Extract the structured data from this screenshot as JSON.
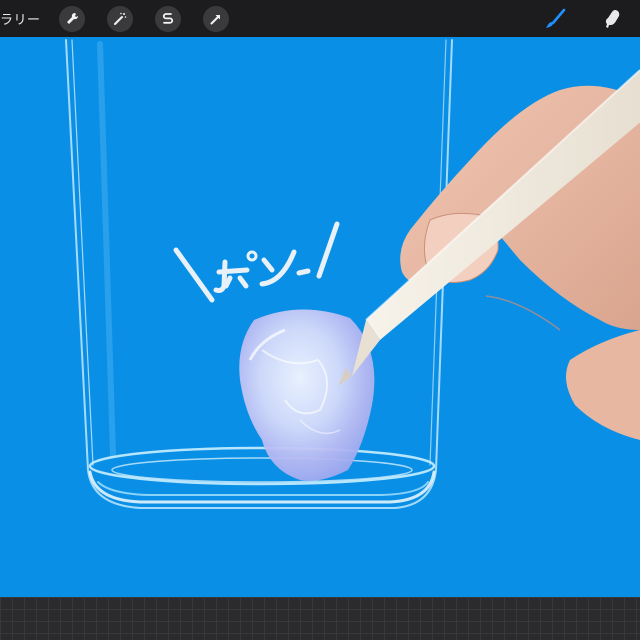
{
  "toolbar": {
    "gallery_label": "ラリー",
    "left_tools": [
      {
        "icon": "wrench-icon"
      },
      {
        "icon": "magic-wand-icon"
      },
      {
        "icon": "selection-s-icon"
      },
      {
        "icon": "arrow-transform-icon"
      }
    ],
    "right_tools": [
      {
        "icon": "brush-icon",
        "active": true
      },
      {
        "icon": "smudge-icon",
        "active": false
      }
    ],
    "accent_color": "#1e90ff"
  },
  "canvas": {
    "background_color": "#0a8fe6",
    "handwritten_text": "\\ポン/"
  }
}
